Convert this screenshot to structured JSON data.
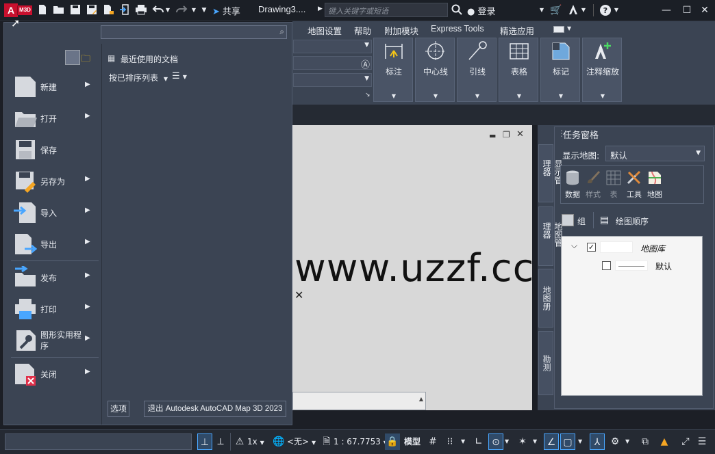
{
  "titlebar": {
    "logo_letter": "A",
    "logo_product": "M3D",
    "share_label": "共享",
    "document_title": "Drawing3....",
    "search_placeholder": "键入关键字或短语",
    "login_label": "登录"
  },
  "ribbon": {
    "tabs": [
      "地图设置",
      "帮助",
      "附加模块",
      "Express Tools",
      "精选应用"
    ],
    "buttons": [
      "标注",
      "中心线",
      "引线",
      "表格",
      "标记",
      "注释缩放"
    ]
  },
  "app_menu": {
    "search_placeholder": "",
    "recent_docs_title": "最近使用的文档",
    "sort_label": "按已排序列表",
    "items": [
      {
        "label": "新建",
        "has_submenu": true
      },
      {
        "label": "打开",
        "has_submenu": true
      },
      {
        "label": "保存",
        "has_submenu": false
      },
      {
        "label": "另存为",
        "has_submenu": true
      },
      {
        "label": "导入",
        "has_submenu": true
      },
      {
        "label": "导出",
        "has_submenu": true
      },
      {
        "label": "发布",
        "has_submenu": true
      },
      {
        "label": "打印",
        "has_submenu": true
      },
      {
        "label": "图形实用程序",
        "has_submenu": true
      },
      {
        "label": "关闭",
        "has_submenu": true
      }
    ],
    "options_button": "选项",
    "exit_button": "退出 Autodesk AutoCAD Map 3D 2023"
  },
  "canvas": {
    "watermark": "www.uzzf.cc"
  },
  "task_pane": {
    "title": "任务窗格",
    "display_map_label": "显示地图:",
    "display_map_value": "默认",
    "tools": [
      "数据",
      "样式",
      "表",
      "工具",
      "地图"
    ],
    "group_label": "组",
    "draw_order_label": "绘图顺序",
    "vertical_tabs": [
      "显示管理器",
      "地图管理器",
      "地图册",
      "勘测"
    ],
    "tree": {
      "root_label": "地图库",
      "child_label": "默认"
    }
  },
  "statusbar": {
    "scale_factor": "1x",
    "coord_system": "<无>",
    "scale_ratio": "1 : 67.7753",
    "model_label": "模型"
  },
  "colors": {
    "accent": "#49a6ff",
    "logo_red": "#c8102e",
    "panel": "#3b4453",
    "warning": "#f5a623"
  }
}
